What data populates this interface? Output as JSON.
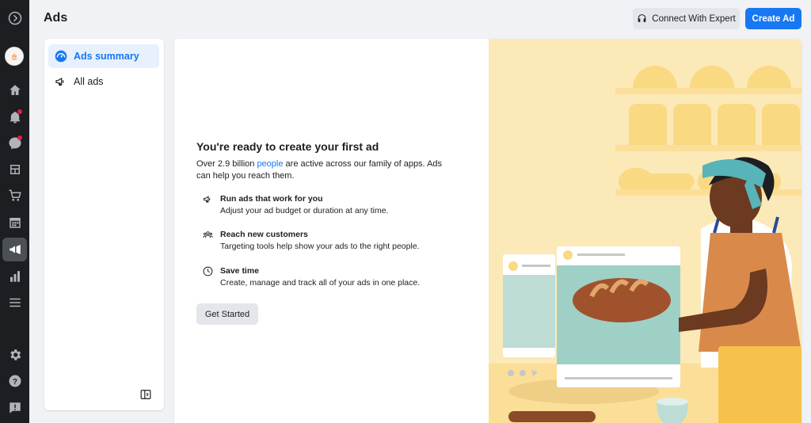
{
  "header": {
    "title": "Ads",
    "connect_expert_label": "Connect With Expert",
    "create_ad_label": "Create Ad"
  },
  "sidebar_nav": {
    "items": [
      {
        "label": "Ads summary",
        "icon": "dashboard-icon",
        "active": true
      },
      {
        "label": "All ads",
        "icon": "megaphone-icon",
        "active": false
      }
    ]
  },
  "rail": {
    "icons": [
      "meta-logo-icon",
      "avatar",
      "home-icon",
      "notifications-icon",
      "messages-icon",
      "pages-icon",
      "shop-icon",
      "calendar-icon",
      "ads-icon",
      "insights-icon",
      "menu-icon",
      "settings-icon",
      "help-icon",
      "feedback-icon"
    ],
    "active": "ads-icon"
  },
  "main": {
    "heading": "You're ready to create your first ad",
    "intro_before": "Over 2.9 billion ",
    "intro_link": "people",
    "intro_after": " are active across our family of apps. Ads can help you reach them.",
    "features": [
      {
        "icon": "megaphone-icon",
        "title": "Run ads that work for you",
        "description": "Adjust your ad budget or duration at any time."
      },
      {
        "icon": "people-icon",
        "title": "Reach new customers",
        "description": "Targeting tools help show your ads to the right people."
      },
      {
        "icon": "clock-icon",
        "title": "Save time",
        "description": "Create, manage and track all of your ads in one place."
      }
    ],
    "get_started_label": "Get Started"
  },
  "colors": {
    "accent": "#1877f2",
    "rail_bg": "#1c1e21",
    "page_bg": "#f0f2f5",
    "illustration_bg": "#fce9b8"
  }
}
